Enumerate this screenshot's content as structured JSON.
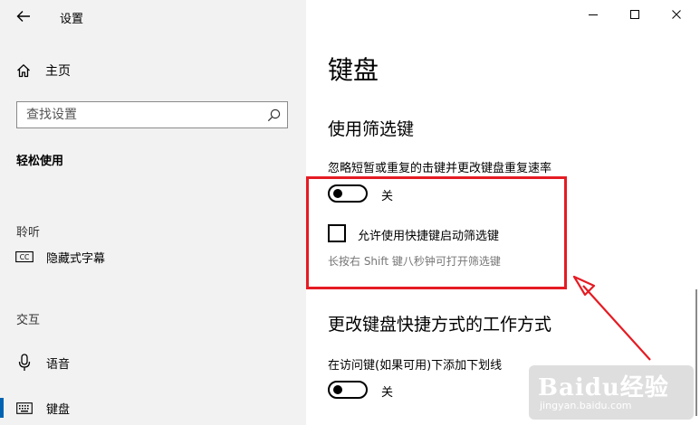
{
  "window": {
    "title": "设置",
    "controls": {
      "minimize": "—",
      "maximize": "☐",
      "close": "✕"
    }
  },
  "sidebar": {
    "home_label": "主页",
    "search_placeholder": "查找设置",
    "section_title": "轻松使用",
    "groups": [
      {
        "label": "聆听",
        "items": [
          {
            "label": "隐藏式字幕",
            "icon": "closed-captions-icon"
          }
        ]
      },
      {
        "label": "交互",
        "items": [
          {
            "label": "语音",
            "icon": "microphone-icon"
          },
          {
            "label": "键盘",
            "icon": "keyboard-icon",
            "selected": true
          }
        ]
      }
    ],
    "accent_color": "#0063b1"
  },
  "main": {
    "page_title": "键盘",
    "filter_keys": {
      "heading": "使用筛选键",
      "description": "忽略短暂或重复的击键并更改键盘重复速率",
      "toggle_state": "关",
      "toggle_on": false,
      "checkbox_label": "允许使用快捷键启动筛选键",
      "checkbox_checked": false,
      "hint": "长按右 Shift 键八秒钟可打开筛选键"
    },
    "shortcuts": {
      "heading": "更改键盘快捷方式的工作方式",
      "description": "在访问键(如果可用)下添加下划线",
      "toggle_state": "关",
      "toggle_on": false
    }
  },
  "annotation": {
    "highlight_color": "#e51b23"
  },
  "watermark": {
    "logo": "Baidu经验",
    "url": "jingyan.baidu.com"
  }
}
